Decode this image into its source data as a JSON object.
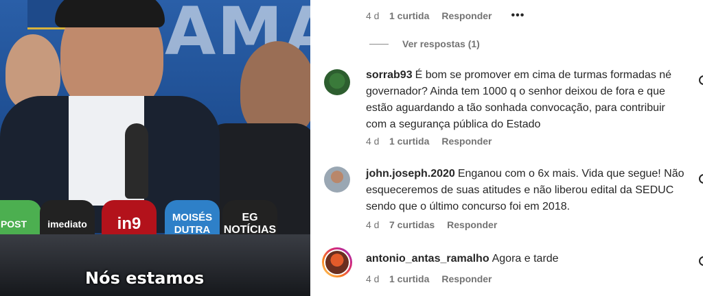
{
  "video": {
    "banner_text": "AMA",
    "caption": "Nós estamos",
    "mic_labels": [
      "POST",
      "imediato",
      "in9",
      "MOISÉS DUTRA",
      "EG NOTÍCIAS"
    ]
  },
  "top_comment": {
    "age": "4 d",
    "likes": "1 curtida",
    "reply": "Responder",
    "more": "•••"
  },
  "view_replies": "Ver respostas (1)",
  "comments": [
    {
      "username": "sorrab93",
      "text": "É bom se promover em cima de turmas formadas né governador? Ainda tem 1000 q o senhor deixou de fora e que estão aguardando a tão sonhada convocação, para contribuir com a segurança pública do Estado",
      "age": "4 d",
      "likes": "1 curtida",
      "reply": "Responder"
    },
    {
      "username": "john.joseph.2020",
      "text": "Enganou com o 6x mais. Vida que segue! Não esqueceremos de suas atitudes e não liberou edital da SEDUC sendo que o último concurso foi em 2018.",
      "age": "4 d",
      "likes": "7 curtidas",
      "reply": "Responder"
    },
    {
      "username": "antonio_antas_ramalho",
      "text": "Agora e tarde",
      "age": "4 d",
      "likes": "1 curtida",
      "reply": "Responder"
    }
  ]
}
